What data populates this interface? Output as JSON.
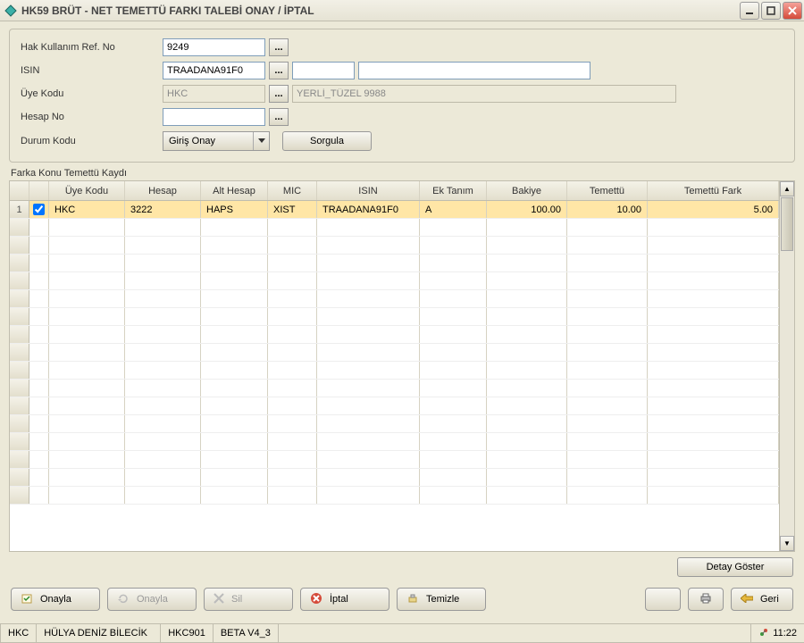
{
  "window": {
    "title": "HK59 BRÜT - NET TEMETTÜ FARKI TALEBİ ONAY / İPTAL"
  },
  "form": {
    "labels": {
      "ref_no": "Hak Kullanım Ref. No",
      "isin": "ISIN",
      "uye_kodu": "Üye Kodu",
      "hesap_no": "Hesap No",
      "durum_kodu": "Durum Kodu"
    },
    "values": {
      "ref_no": "9249",
      "isin": "TRAADANA91F0",
      "isin_extra1": "",
      "isin_extra2": "",
      "uye_kodu": "HKC",
      "uye_kodu_desc": "YERLİ_TÜZEL 9988",
      "hesap_no": "",
      "durum_kodu": "Giriş Onay"
    },
    "buttons": {
      "lookup": "...",
      "sorgula": "Sorgula"
    }
  },
  "grid": {
    "legend": "Farka Konu Temettü Kaydı",
    "headers": {
      "uye_kodu": "Üye Kodu",
      "hesap": "Hesap",
      "alt_hesap": "Alt Hesap",
      "mic": "MIC",
      "isin": "ISIN",
      "ek_tanim": "Ek Tanım",
      "bakiye": "Bakiye",
      "temettu": "Temettü",
      "temettu_fark": "Temettü Fark"
    },
    "rows": [
      {
        "num": "1",
        "checked": true,
        "uye_kodu": "HKC",
        "hesap": "3222",
        "alt_hesap": "HAPS",
        "mic": "XIST",
        "isin": "TRAADANA91F0",
        "ek_tanim": "A",
        "bakiye": "100.00",
        "temettu": "10.00",
        "temettu_fark": "5.00"
      }
    ],
    "detail_button": "Detay Göster"
  },
  "actions": {
    "onayla": "Onayla",
    "onayla2": "Onayla",
    "sil": "Sil",
    "iptal": "İptal",
    "temizle": "Temizle",
    "geri": "Geri"
  },
  "statusbar": {
    "cell1": "HKC",
    "cell2": "HÜLYA DENİZ BİLECİK",
    "cell3": "HKC901",
    "cell4": "BETA V4_3",
    "time": "11:22"
  }
}
